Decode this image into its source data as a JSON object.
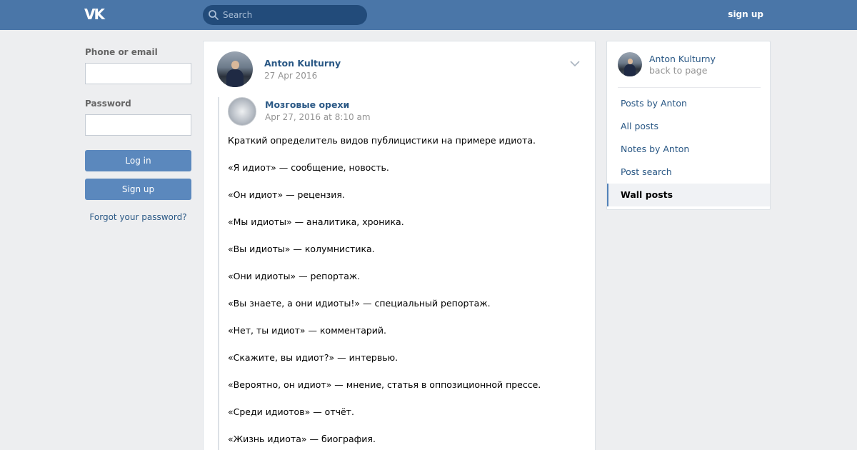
{
  "header": {
    "logo_text": "VK",
    "search_placeholder": "Search",
    "signup_label": "sign up"
  },
  "login": {
    "phone_label": "Phone or email",
    "phone_value": "",
    "password_label": "Password",
    "password_value": "",
    "login_button": "Log in",
    "signup_button": "Sign up",
    "forgot_link": "Forgot your password?"
  },
  "post": {
    "author": "Anton Kulturny",
    "date": "27 Apr 2016",
    "repost": {
      "author": "Мозговые орехи",
      "date": "Apr 27, 2016 at 8:10 am",
      "lines": [
        "Краткий определитель видов публицистики на примере идиота.",
        "«Я идиот» — сообщение, новость.",
        "«Он идиот» — рецензия.",
        "«Мы идиоты» — аналитика, хроника.",
        "«Вы идиоты» — колумнистика.",
        "«Они идиоты» — репортаж.",
        "«Вы знаете, а они идиоты!» — специальный репортаж.",
        "«Нет, ты идиот» — комментарий.",
        "«Скажите, вы идиот?» — интервью.",
        "«Вероятно, он идиот» — мнение, статья в оппозиционной прессе.",
        "«Среди идиотов» — отчёт.",
        "«Жизнь идиота» — биография."
      ]
    }
  },
  "sidebar": {
    "name": "Anton Kulturny",
    "back": "back to page",
    "items": [
      {
        "label": "Posts by Anton"
      },
      {
        "label": "All posts"
      },
      {
        "label": "Notes by Anton"
      },
      {
        "label": "Post search"
      },
      {
        "label": "Wall posts"
      }
    ],
    "active_index": 4
  },
  "colors": {
    "header": "#4a76a8",
    "link": "#2a5885",
    "button": "#5b88bd",
    "background": "#edeef0"
  }
}
